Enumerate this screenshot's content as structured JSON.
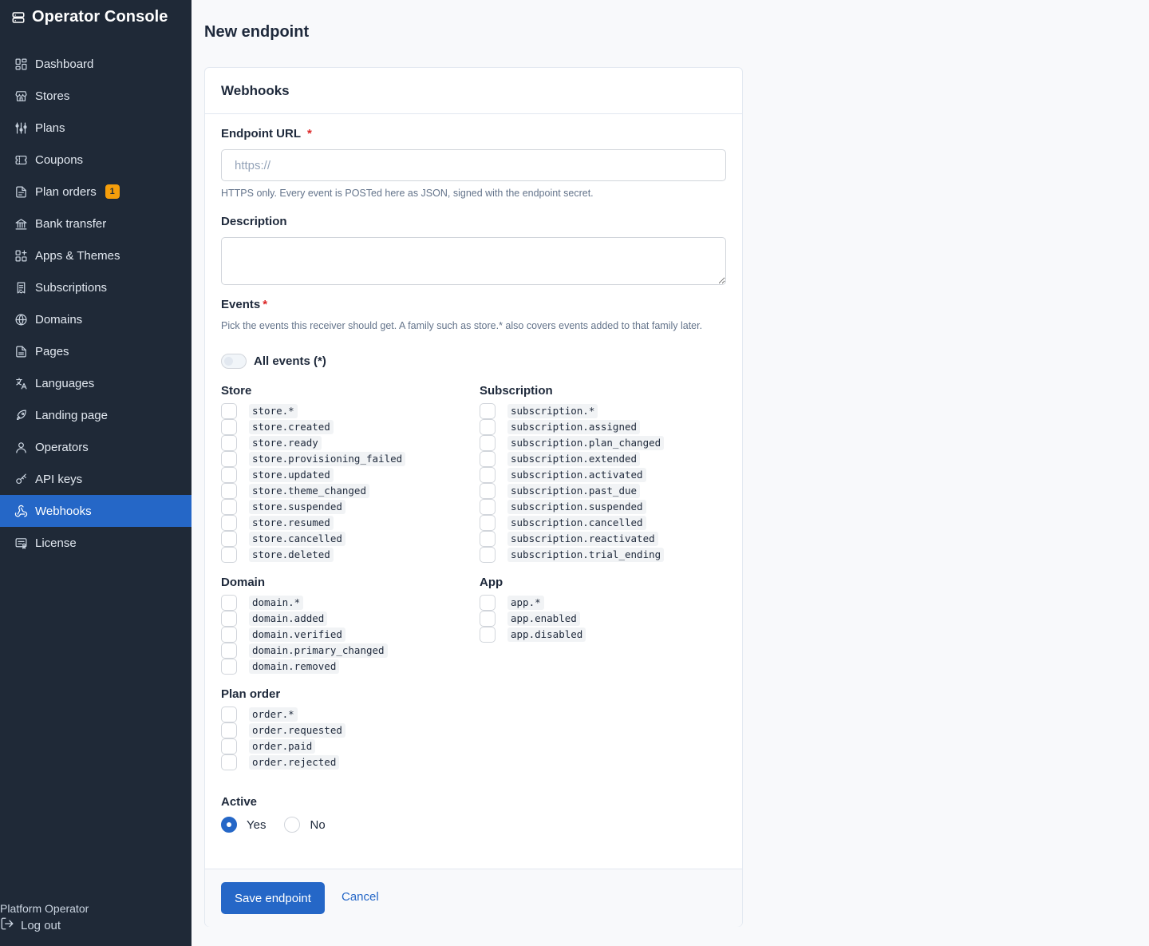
{
  "app": {
    "title": "Operator Console"
  },
  "sidebar": {
    "items": [
      {
        "label": "Dashboard",
        "icon": "dashboard-icon"
      },
      {
        "label": "Stores",
        "icon": "store-icon"
      },
      {
        "label": "Plans",
        "icon": "sliders-icon"
      },
      {
        "label": "Coupons",
        "icon": "ticket-icon"
      },
      {
        "label": "Plan orders",
        "icon": "file-icon",
        "badge": "1"
      },
      {
        "label": "Bank transfer",
        "icon": "bank-icon"
      },
      {
        "label": "Apps & Themes",
        "icon": "apps-icon"
      },
      {
        "label": "Subscriptions",
        "icon": "receipt-icon"
      },
      {
        "label": "Domains",
        "icon": "globe-icon"
      },
      {
        "label": "Pages",
        "icon": "page-icon"
      },
      {
        "label": "Languages",
        "icon": "languages-icon"
      },
      {
        "label": "Landing page",
        "icon": "rocket-icon"
      },
      {
        "label": "Operators",
        "icon": "user-icon"
      },
      {
        "label": "API keys",
        "icon": "key-icon"
      },
      {
        "label": "Webhooks",
        "icon": "webhook-icon",
        "active": true
      },
      {
        "label": "License",
        "icon": "license-icon"
      }
    ],
    "footer": {
      "operator": "Platform Operator",
      "logout": "Log out"
    }
  },
  "page": {
    "title": "New endpoint"
  },
  "form": {
    "card_title": "Webhooks",
    "url": {
      "label": "Endpoint URL",
      "required": "*",
      "placeholder": "https://",
      "value": "",
      "help": "HTTPS only. Every event is POSTed here as JSON, signed with the endpoint secret."
    },
    "description": {
      "label": "Description",
      "value": ""
    },
    "events": {
      "label": "Events",
      "required": "*",
      "help": "Pick the events this receiver should get. A family such as store.* also covers events added to that family later.",
      "all_label": "All events (*)",
      "all_enabled": false,
      "groups": {
        "store": {
          "title": "Store",
          "items": [
            "store.*",
            "store.created",
            "store.ready",
            "store.provisioning_failed",
            "store.updated",
            "store.theme_changed",
            "store.suspended",
            "store.resumed",
            "store.cancelled",
            "store.deleted"
          ]
        },
        "subscription": {
          "title": "Subscription",
          "items": [
            "subscription.*",
            "subscription.assigned",
            "subscription.plan_changed",
            "subscription.extended",
            "subscription.activated",
            "subscription.past_due",
            "subscription.suspended",
            "subscription.cancelled",
            "subscription.reactivated",
            "subscription.trial_ending"
          ]
        },
        "domain": {
          "title": "Domain",
          "items": [
            "domain.*",
            "domain.added",
            "domain.verified",
            "domain.primary_changed",
            "domain.removed"
          ]
        },
        "app": {
          "title": "App",
          "items": [
            "app.*",
            "app.enabled",
            "app.disabled"
          ]
        },
        "order": {
          "title": "Plan order",
          "items": [
            "order.*",
            "order.requested",
            "order.paid",
            "order.rejected"
          ]
        }
      }
    },
    "active": {
      "label": "Active",
      "yes": "Yes",
      "no": "No",
      "selected": "Yes"
    },
    "actions": {
      "save": "Save endpoint",
      "cancel": "Cancel"
    }
  },
  "colors": {
    "sidebar_bg": "#1f2937",
    "accent": "#2567c7",
    "badge": "#f59e0b",
    "required": "#dc2626"
  }
}
